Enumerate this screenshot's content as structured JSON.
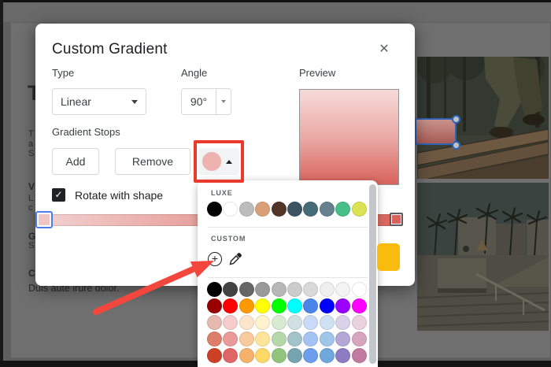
{
  "dialog": {
    "title": "Custom Gradient",
    "close_icon": "✕",
    "fields": {
      "type_label": "Type",
      "type_value": "Linear",
      "angle_label": "Angle",
      "angle_value": "90°",
      "preview_label": "Preview"
    },
    "stops": {
      "section_label": "Gradient Stops",
      "add_label": "Add",
      "remove_label": "Remove",
      "rotate_label": "Rotate with shape",
      "checkbox_check": "✓",
      "gradient_start": "#f3d2d0",
      "gradient_end": "#d8635c",
      "selected_stop_color": "#f0c6c4",
      "end_stop_color": "#d8635c",
      "color_button_swatch": "#eeb2af"
    }
  },
  "color_menu": {
    "luxe_label": "LUXE",
    "custom_label": "CUSTOM",
    "plus_icon": "+",
    "luxe_colors": [
      "#050505",
      "#ffffff",
      "#bdbdbd",
      "#d9a078",
      "#533429",
      "#3c5362",
      "#456b77",
      "#66808e",
      "#48bf86",
      "#dbe253"
    ],
    "palette": [
      [
        "#000000",
        "#434343",
        "#666666",
        "#999999",
        "#b7b7b7",
        "#cccccc",
        "#d9d9d9",
        "#efefef",
        "#f3f3f3",
        "#ffffff"
      ],
      [
        "#980000",
        "#ff0000",
        "#ff9900",
        "#ffff00",
        "#00ff00",
        "#00ffff",
        "#4a86e8",
        "#0000ff",
        "#9900ff",
        "#ff00ff"
      ],
      [
        "#e6b8af",
        "#f4cccc",
        "#fce5cd",
        "#fff2cc",
        "#d9ead3",
        "#d0e0e3",
        "#c9daf8",
        "#cfe2f3",
        "#d9d2e9",
        "#ead1dc"
      ],
      [
        "#dd7e6b",
        "#ea9999",
        "#f9cb9c",
        "#ffe599",
        "#b6d7a8",
        "#a2c4c9",
        "#a4c2f4",
        "#9fc5e8",
        "#b4a7d6",
        "#d5a6bd"
      ],
      [
        "#cc4125",
        "#e06666",
        "#f6b26b",
        "#ffd966",
        "#93c47d",
        "#76a5af",
        "#6d9eeb",
        "#6fa8dc",
        "#8e7cc3",
        "#c27ba0"
      ]
    ]
  },
  "background": {
    "fragments": {
      "heading": "T",
      "l1": "T",
      "l2": "a",
      "l3": "S",
      "l4": "V",
      "l5": "L",
      "l6": "c",
      "l7": "G",
      "l8": "S",
      "l9": "C"
    },
    "caption": "Duis aute irure dolor."
  },
  "annotations": {
    "highlight_color": "#e93a2b",
    "arrow_color": "#f3473d"
  },
  "colors": {
    "yellow_shape": "#f9bb0e",
    "selection_blue": "#2f62b5",
    "focus_blue": "#4e7de9"
  }
}
